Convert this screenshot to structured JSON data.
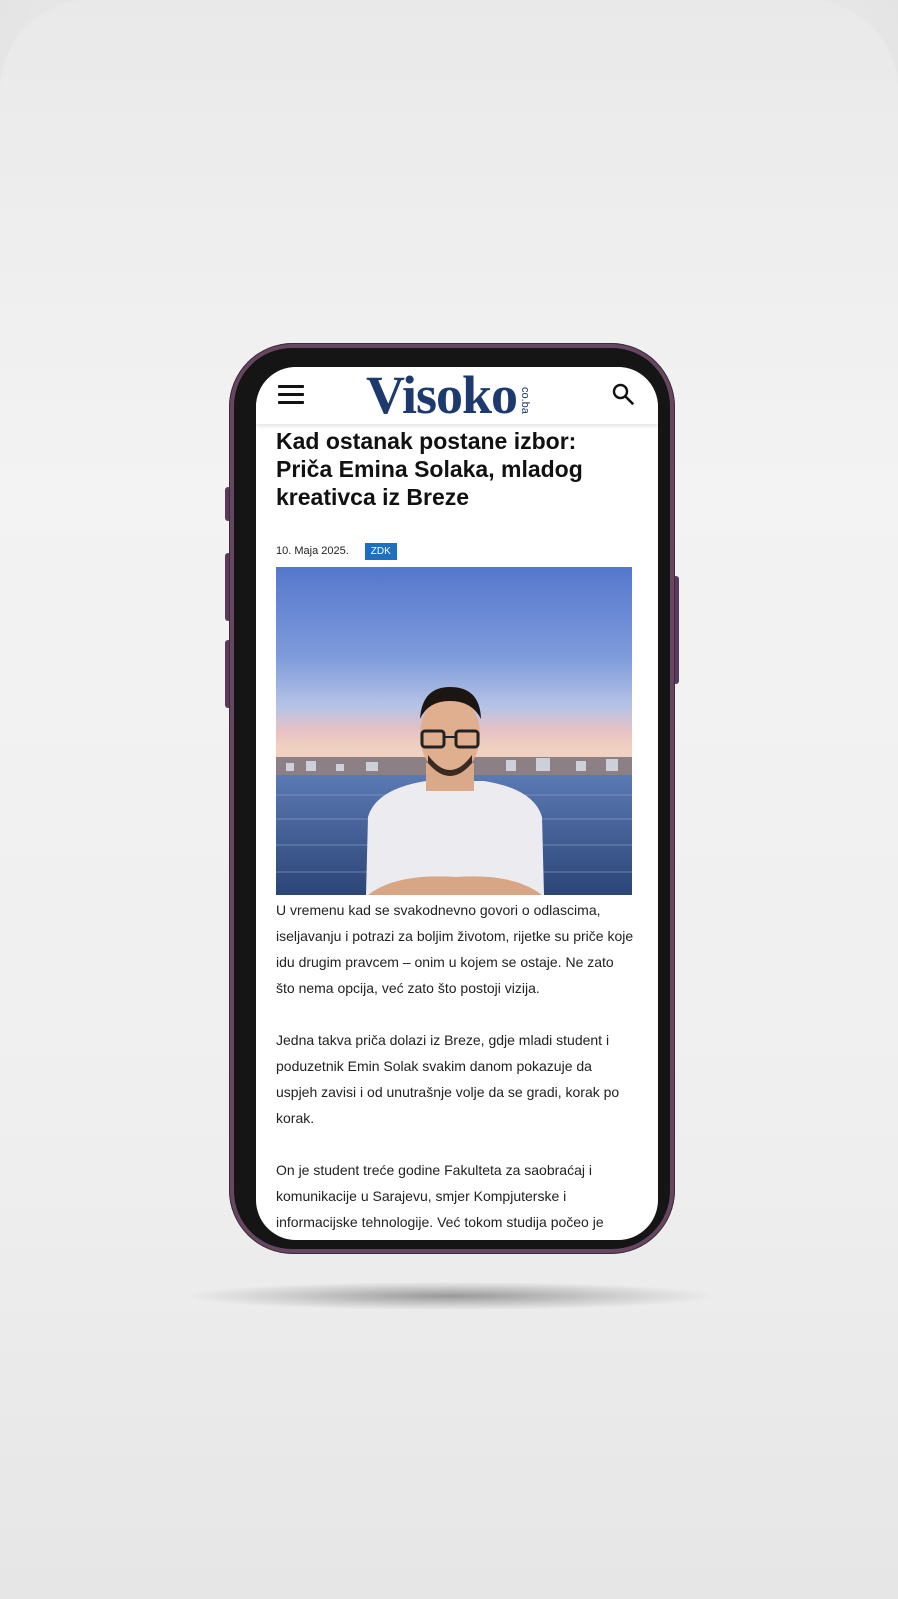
{
  "header": {
    "logo_text": "Visoko",
    "logo_suffix": "co.ba",
    "menu_icon": "hamburger-menu-icon",
    "search_icon": "search-icon"
  },
  "article": {
    "title": "Kad ostanak postane izbor: Priča Emina Solaka, mladog kreativca iz Breze",
    "date": "10. Maja 2025.",
    "category": "ZDK",
    "paragraphs": [
      "U vremenu kad se svakodnevno govori o odlascima, iseljavanju i potrazi za boljim životom, rijetke su priče koje idu drugim pravcem – onim u kojem se ostaje. Ne zato što nema opcija, već zato što postoji vizija.",
      "Jedna takva priča dolazi iz Breze, gdje mladi student i poduzetnik Emin Solak svakim danom pokazuje da uspjeh zavisi i od unutrašnje volje da se gradi, korak po korak.",
      "On je student treće godine Fakulteta za saobraćaj i komunikacije u Sarajevu, smjer Kompjuterske i informacijske tehnologije. Već tokom studija počeo je"
    ]
  },
  "colors": {
    "brand": "#1d3a6e",
    "badge": "#1f6fc0",
    "phone_frame": "#66475f"
  }
}
